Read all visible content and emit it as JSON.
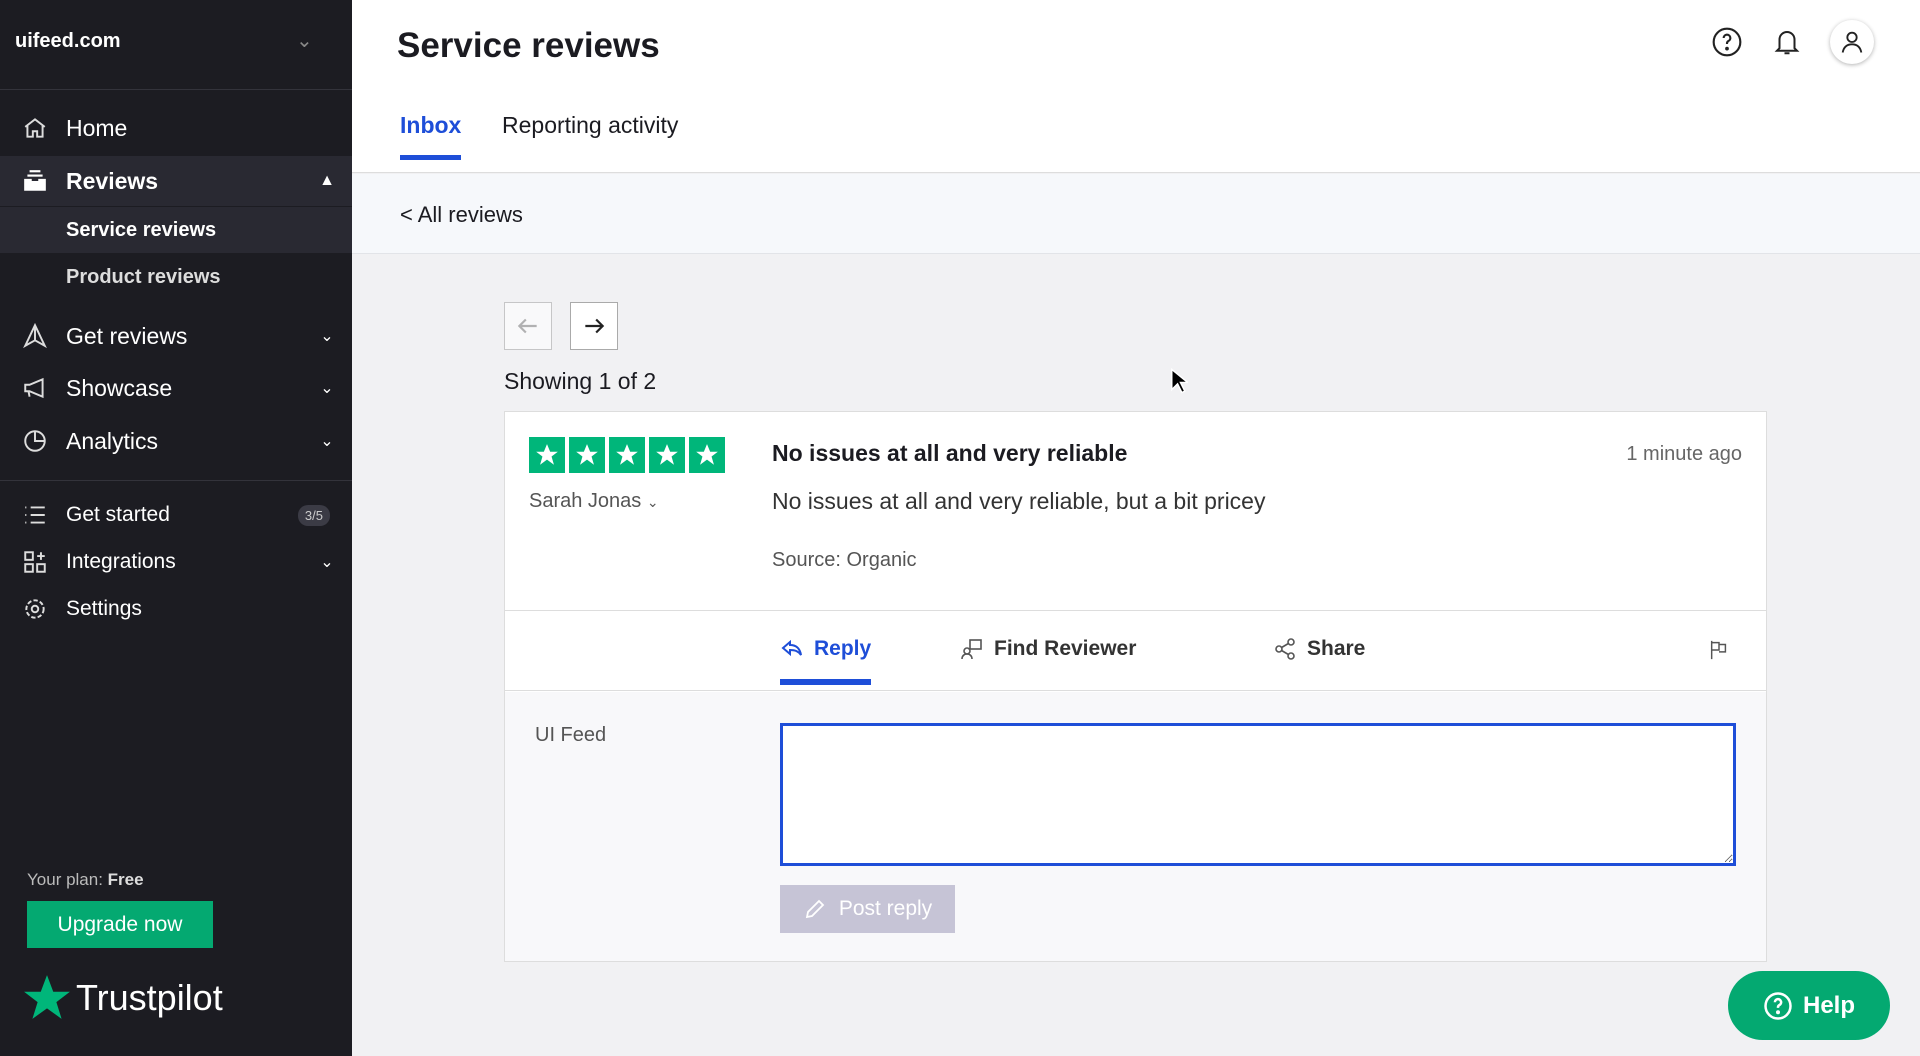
{
  "sidebar": {
    "org": "uifeed.com",
    "items": {
      "home": "Home",
      "reviews": "Reviews",
      "service": "Service reviews",
      "product": "Product reviews",
      "get": "Get reviews",
      "showcase": "Showcase",
      "analytics": "Analytics",
      "started": "Get started",
      "started_badge": "3/5",
      "integrations": "Integrations",
      "settings": "Settings"
    },
    "plan_label": "Your plan:",
    "plan_value": "Free",
    "upgrade": "Upgrade now",
    "logo": "Trustpilot"
  },
  "header": {
    "title": "Service reviews",
    "tabs": [
      "Inbox",
      "Reporting activity"
    ]
  },
  "breadcrumb": "< All reviews",
  "pager": {
    "showing": "Showing 1 of 2"
  },
  "review": {
    "rating": 5,
    "reviewer": "Sarah Jonas",
    "title": "No issues at all and very reliable",
    "time": "1 minute ago",
    "body": "No issues at all and very reliable, but a bit pricey",
    "source": "Source: Organic"
  },
  "actions": {
    "reply": "Reply",
    "share": "Share",
    "find": "Find Reviewer"
  },
  "reply": {
    "author": "UI Feed",
    "value": "",
    "post": "Post reply"
  },
  "help": "Help",
  "colors": {
    "accent": "#1e4ed8",
    "star": "#00b67a",
    "sidebar": "#1c1c22",
    "help": "#04a971"
  }
}
